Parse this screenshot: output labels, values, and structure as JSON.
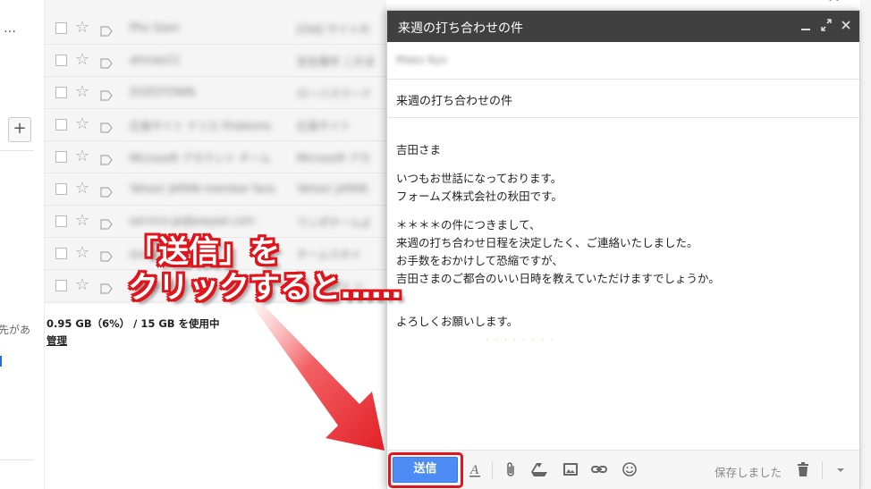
{
  "sidebar": {
    "dots": "…",
    "add_label": "+",
    "cut_text": "先があ"
  },
  "top_hint": "⊷",
  "mail_rows": [
    {
      "sender": "Pho Siam",
      "subject": "[Old] サイトの"
    },
    {
      "sender": "ahmae21",
      "subject": "定在庫件 このま"
    },
    {
      "sender": "ZOZOTOWN",
      "subject": "ローバスワード"
    },
    {
      "sender": "広島サイト ドリエ Fireboms",
      "subject": "広島サイト"
    },
    {
      "sender": "Microsoft アカウント チーム",
      "subject": "Microsoft アカ"
    },
    {
      "sender": "Yahoo! JAPAN member fans",
      "subject": "Yahoo! JAPAN"
    },
    {
      "sender": "service-jp@paypal.com",
      "subject": "ワンポチームよ"
    },
    {
      "sender": "Gmail チーム",
      "subject": "チームスタイ"
    },
    {
      "sender": "Gmail チーム",
      "subject": "アークセス リ"
    }
  ],
  "storage": {
    "usage": "0.95 GB（6%） / 15 GB を使用中",
    "manage": "管理"
  },
  "annotation": {
    "line1": "「送信」を",
    "line2": "クリックすると……"
  },
  "compose": {
    "title": "来週の打ち合わせの件",
    "to": "Mako Kyo",
    "subject": "来週の打ち合わせの件",
    "body": {
      "greeting": "吉田さま",
      "intro1": "いつもお世話になっております。",
      "intro2": "フォームズ株式会社の秋田です。",
      "p1": "＊＊＊＊の件につきまして、",
      "p2": "来週の打ち合わせ日程を決定したく、ご連絡いたしました。",
      "p3": "お手数をおかけして恐縮ですが、",
      "p4": "吉田さまのご都合のいい日時を教えていただけますでしょうか。",
      "closing": "よろしくお願いします。"
    },
    "send_label": "送信",
    "saved_label": "保存しました"
  },
  "colors": {
    "header_bg": "#404040",
    "send_blue": "#4d8bf5",
    "annotation_red": "#e0151b"
  }
}
